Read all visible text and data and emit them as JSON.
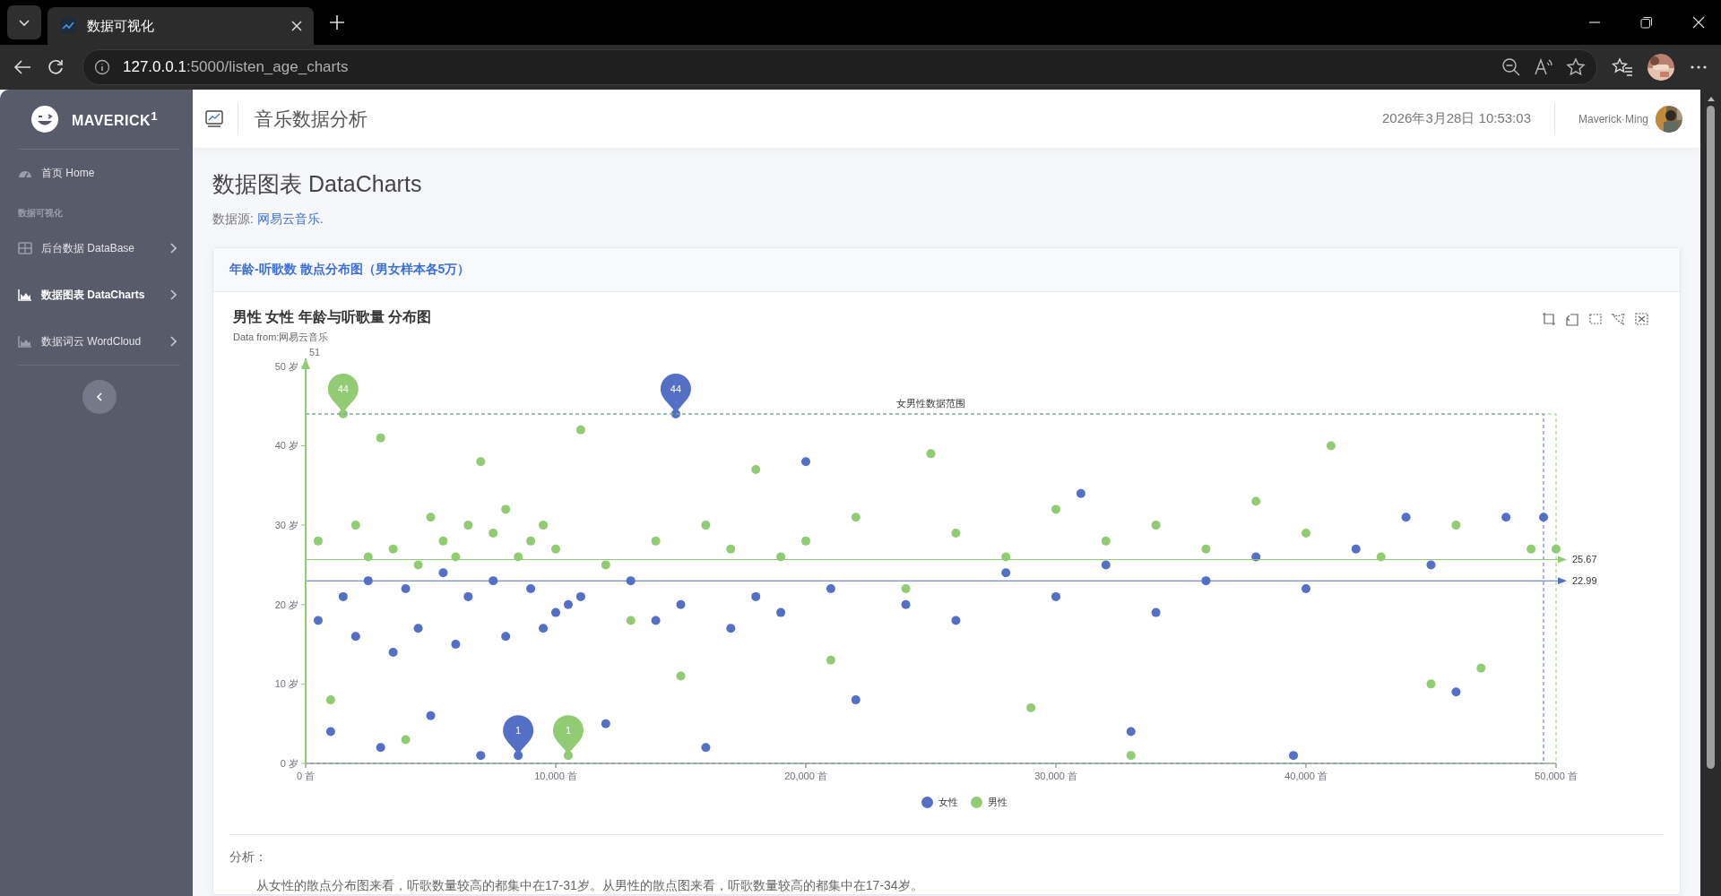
{
  "browser": {
    "tabs": [
      {
        "title": "数据可视化",
        "selected": true
      }
    ],
    "url_host": "127.0.0.1",
    "url_path": ":5000/listen_age_charts"
  },
  "sidebar": {
    "brand": "MAVERICK$^{1}$",
    "items": [
      {
        "kind": "home",
        "label": "首页 Home",
        "selected": false,
        "chevron": false
      },
      {
        "kind": "heading",
        "label": "数据可视化"
      },
      {
        "kind": "table",
        "label": "后台数据 DataBase",
        "selected": false,
        "chevron": true
      },
      {
        "kind": "chart",
        "label": "数据图表 DataCharts",
        "selected": true,
        "chevron": true
      },
      {
        "kind": "chart",
        "label": "数据词云 WordCloud",
        "selected": false,
        "chevron": true
      }
    ]
  },
  "header": {
    "title": "音乐数据分析",
    "datetime": "2026年3月28日 10:53:03",
    "user": "Maverick·Ming"
  },
  "page": {
    "title": "数据图表 DataCharts",
    "source_label": "数据源:",
    "source_link": "网易云音乐."
  },
  "card": {
    "title": "年龄-听歌数 散点分布图（男女样本各5万）",
    "chart_subtitle": "Data from:网易云音乐",
    "chart_data": {
      "type": "scatter",
      "title": "男性 女性 年龄与听歌量 分布图",
      "xlim": [
        0,
        50000
      ],
      "ylim": [
        0,
        51
      ],
      "xticks": [
        {
          "value": 0,
          "label": "0 首"
        },
        {
          "value": 10000,
          "label": "10,000 首"
        },
        {
          "value": 20000,
          "label": "20,000 首"
        },
        {
          "value": 30000,
          "label": "30,000 首"
        },
        {
          "value": 40000,
          "label": "40,000 首"
        },
        {
          "value": 50000,
          "label": "50,000 首"
        }
      ],
      "yticks": [
        {
          "value": 0,
          "label": "0 岁"
        },
        {
          "value": 10,
          "label": "10 岁"
        },
        {
          "value": 20,
          "label": "20 岁"
        },
        {
          "value": 30,
          "label": "30 岁"
        },
        {
          "value": 40,
          "label": "40 岁"
        },
        {
          "value": 50,
          "label": "50 岁"
        }
      ],
      "legend": "bottom",
      "ref_lines": [
        {
          "axis": "y",
          "value": 25.67,
          "label": "25.67",
          "color": "#91cc75"
        },
        {
          "axis": "y",
          "value": 22.99,
          "label": "22.99",
          "color": "#5470c6"
        }
      ],
      "annotations": [
        {
          "text": "44",
          "x": 1500,
          "y": 44
        },
        {
          "text": "44",
          "x": 14800,
          "y": 44
        },
        {
          "text": "1",
          "x": 8500,
          "y": 1
        },
        {
          "text": "1",
          "x": 10500,
          "y": 1
        }
      ],
      "x": [
        500,
        1000,
        1500,
        2000,
        2500,
        3000,
        3500,
        4000,
        4500,
        5000,
        5500,
        6000,
        6500,
        7000,
        7500,
        8000,
        8500,
        9000,
        9500,
        10000,
        10500,
        11000,
        12000,
        13000,
        14000,
        14800,
        15000,
        16000,
        17000,
        18000,
        19000,
        20000,
        21000,
        22000,
        24000,
        25000,
        26000,
        28000,
        29000,
        30000,
        31000,
        32000,
        33000,
        34000,
        36000,
        38000,
        39500,
        40000,
        41000,
        42000,
        43000,
        44000,
        45000,
        46000,
        47000,
        48000,
        49000,
        49500,
        50000
      ],
      "series": [
        {
          "name": "女性",
          "color": "#5470c6",
          "values": [
            18,
            4,
            21,
            16,
            23,
            2,
            14,
            22,
            17,
            6,
            24,
            15,
            21,
            1,
            23,
            16,
            1,
            22,
            17,
            19,
            20,
            21,
            5,
            23,
            18,
            44,
            20,
            2,
            17,
            21,
            19,
            38,
            22,
            8,
            20,
            null,
            18,
            24,
            null,
            21,
            34,
            25,
            4,
            19,
            23,
            26,
            1,
            22,
            null,
            27,
            null,
            31,
            25,
            9,
            null,
            31,
            null,
            31,
            null
          ]
        },
        {
          "name": "男性",
          "color": "#91cc75",
          "values": [
            28,
            8,
            44,
            30,
            26,
            41,
            27,
            3,
            25,
            31,
            28,
            26,
            30,
            38,
            29,
            32,
            26,
            28,
            30,
            27,
            1,
            42,
            25,
            18,
            28,
            null,
            11,
            30,
            27,
            37,
            26,
            28,
            13,
            31,
            22,
            39,
            29,
            26,
            7,
            32,
            null,
            28,
            1,
            30,
            27,
            33,
            null,
            29,
            40,
            null,
            26,
            null,
            10,
            30,
            12,
            null,
            27,
            null,
            27
          ]
        }
      ]
    },
    "chart_marks": {
      "axis_end": "51",
      "range_label": "女男性数据范围"
    },
    "analysis_label": "分析：",
    "analysis": "从女性的散点分布图来看，听歌数量较高的都集中在17-31岁。从男性的散点图来看，听歌数量较高的都集中在17-34岁。"
  }
}
